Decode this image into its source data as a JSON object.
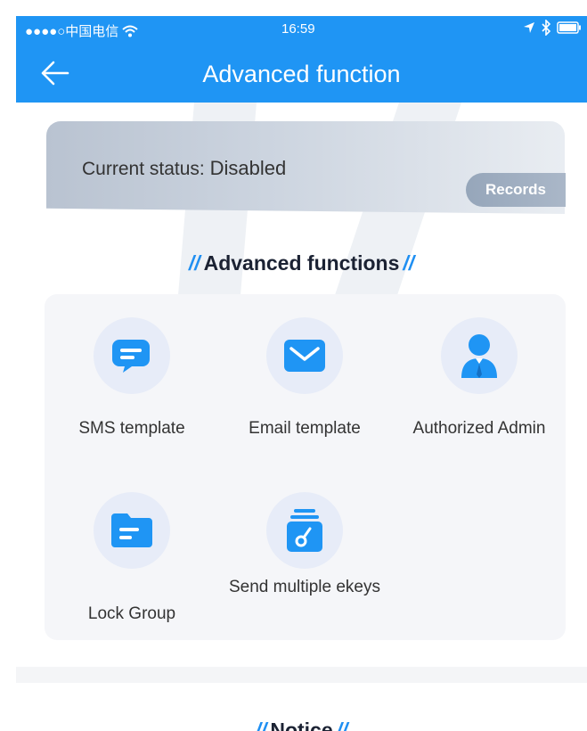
{
  "status_bar": {
    "carrier": "●●●●○中国电信",
    "time": "16:59"
  },
  "nav": {
    "title": "Advanced function"
  },
  "status_card": {
    "label": "Current status:",
    "value": "Disabled",
    "records_button": "Records"
  },
  "functions": {
    "title": "Advanced functions",
    "items": [
      {
        "label": "SMS template",
        "icon": "sms-icon"
      },
      {
        "label": "Email template",
        "icon": "email-icon"
      },
      {
        "label": "Authorized Admin",
        "icon": "admin-icon"
      },
      {
        "label": "Lock Group",
        "icon": "folder-icon"
      },
      {
        "label": "Send multiple ekeys",
        "icon": "ekey-icon"
      }
    ]
  },
  "notice": {
    "title": "Notice"
  },
  "colors": {
    "primary": "#1f95f4",
    "accent": "#1f8ff2"
  }
}
